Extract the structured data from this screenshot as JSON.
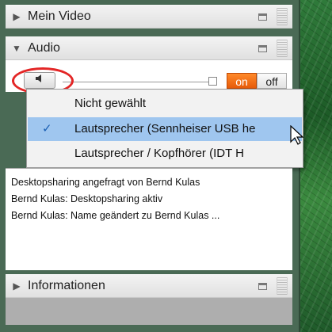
{
  "sections": {
    "video": {
      "title": "Mein Video"
    },
    "audio": {
      "title": "Audio"
    },
    "info": {
      "title": "Informationen"
    }
  },
  "audio_controls": {
    "speaker_icon": "speaker-icon",
    "toggle_on": "on",
    "toggle_off": "off"
  },
  "dropdown": {
    "items": [
      {
        "label": "Nicht gewählt",
        "selected": false
      },
      {
        "label": "Lautsprecher (Sennheiser USB he",
        "selected": true
      },
      {
        "label": "Lautsprecher / Kopfhörer (IDT H",
        "selected": false
      }
    ],
    "check_glyph": "✓"
  },
  "log": [
    "Desktopsharing angefragt von Bernd Kulas",
    "Bernd Kulas: Desktopsharing aktiv",
    "Bernd Kulas: Name geändert zu Bernd Kulas ..."
  ],
  "colors": {
    "accent_on": "#e75b0a",
    "selection": "#9fc6ef",
    "highlight_oval": "#e32626"
  }
}
